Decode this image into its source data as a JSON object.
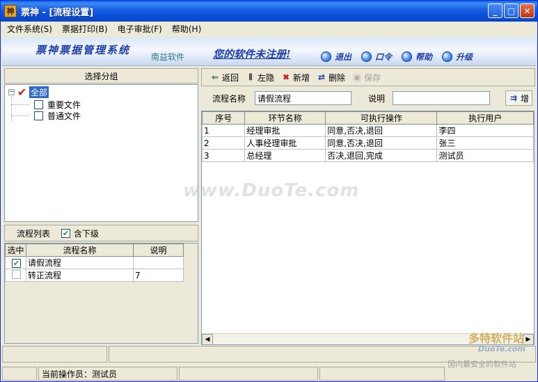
{
  "window": {
    "title": "票神 - [流程设置]",
    "icon_char": "神"
  },
  "title_buttons": {
    "minimize": "_",
    "maximize": "□",
    "close": "✕"
  },
  "menu": [
    {
      "label": "文件系统(S)"
    },
    {
      "label": "票据打印(B)"
    },
    {
      "label": "电子审批(F)"
    },
    {
      "label": "帮助(H)"
    }
  ],
  "banner": {
    "logo_text": "票神票据管理系统",
    "company": "南益软件",
    "unregistered": "您的软件未注册!",
    "actions": [
      {
        "label": "退出",
        "icon": "exit-icon"
      },
      {
        "label": "口令",
        "icon": "key-icon"
      },
      {
        "label": "帮助",
        "icon": "help-icon"
      },
      {
        "label": "升级",
        "icon": "upgrade-icon"
      }
    ]
  },
  "left": {
    "group_header": "选择分组",
    "tree": {
      "root": {
        "label": "全部",
        "expander": "−",
        "checked": true
      },
      "children": [
        {
          "label": "重要文件"
        },
        {
          "label": "普通文件"
        }
      ]
    },
    "flow_list_label": "流程列表",
    "include_sub_label": "含下级",
    "include_sub_checked": true,
    "grid": {
      "headers": [
        "选中",
        "流程名称",
        "说明"
      ],
      "rows": [
        {
          "checked": true,
          "name": "请假流程",
          "note": ""
        },
        {
          "checked": false,
          "name": "转正流程",
          "note": "7"
        }
      ]
    }
  },
  "right": {
    "toolbar": [
      {
        "label": "返回",
        "icon": "back-icon",
        "enabled": true
      },
      {
        "label": "左隐",
        "icon": "hide-left-icon",
        "enabled": true
      },
      {
        "label": "新增",
        "icon": "add-icon",
        "enabled": true
      },
      {
        "label": "删除",
        "icon": "delete-icon",
        "enabled": true
      },
      {
        "label": "保存",
        "icon": "save-icon",
        "enabled": false
      }
    ],
    "form": {
      "flow_name_label": "流程名称",
      "flow_name_value": "请假流程",
      "note_label": "说明",
      "note_value": "",
      "extra_button": "增"
    },
    "grid": {
      "headers": [
        "序号",
        "环节名称",
        "可执行操作",
        "执行用户"
      ],
      "rows": [
        [
          "1",
          "经理审批",
          "同意,否决,退回",
          "李四"
        ],
        [
          "2",
          "人事经理审批",
          "同意,否决,退回",
          "张三"
        ],
        [
          "3",
          "总经理",
          "否决,退回,完成",
          "测试员"
        ]
      ]
    }
  },
  "status": {
    "operator": "当前操作员：测试员"
  },
  "watermarks": {
    "center": "www.DuoTe.com",
    "brand_cn": "多特软件站",
    "brand_en": "DuoTe.com",
    "brand_sub": "国内最安全的软件站"
  }
}
